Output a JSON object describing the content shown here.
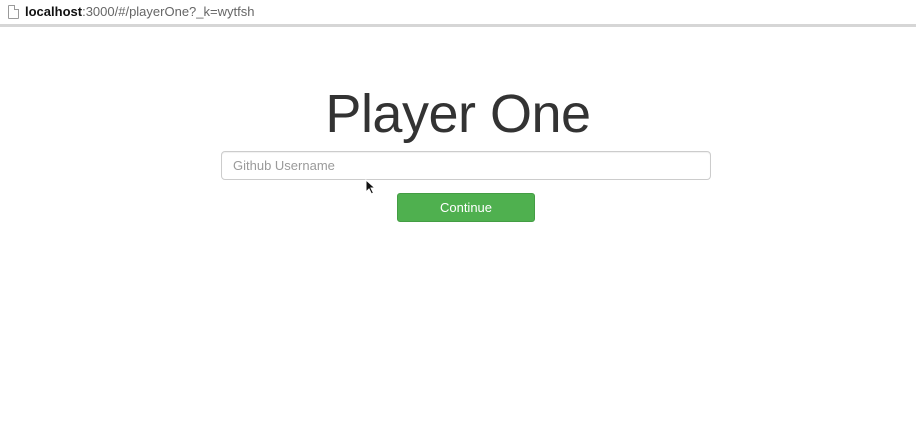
{
  "browser": {
    "url_host": "localhost",
    "url_rest": ":3000/#/playerOne?_k=wytfsh",
    "page_icon": "page-icon"
  },
  "main": {
    "title": "Player One",
    "username_input": {
      "placeholder": "Github Username",
      "value": ""
    },
    "continue_label": "Continue",
    "continue_color": "#4fb04f"
  },
  "cursor": {
    "icon": "mouse-pointer-icon"
  }
}
